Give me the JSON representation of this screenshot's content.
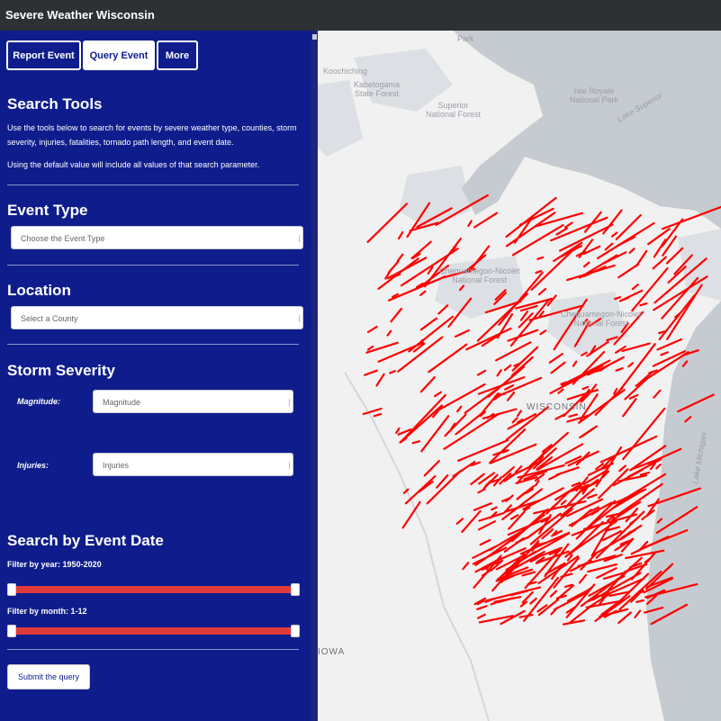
{
  "app": {
    "title": "Severe Weather Wisconsin"
  },
  "tabs": [
    {
      "label": "Report Event",
      "active": false
    },
    {
      "label": "Query Event",
      "active": true
    },
    {
      "label": "More",
      "active": false
    }
  ],
  "search_tools": {
    "title": "Search Tools",
    "description": "Use the tools below to search for events by severe weather type, counties, storm severity, injuries, fatalities, tornado path length, and event date.",
    "note": "Using the default value will include all values of that search parameter."
  },
  "event_type": {
    "title": "Event Type",
    "placeholder": "Choose the Event Type"
  },
  "location": {
    "title": "Location",
    "placeholder": "Select a County"
  },
  "storm_severity": {
    "title": "Storm Severity",
    "magnitude_label": "Magnitude:",
    "magnitude_value": "Magnitude",
    "injuries_label": "Injuries:",
    "injuries_value": "Injuries"
  },
  "event_date": {
    "title": "Search by Event Date",
    "year_filter_label": "Filter by year:",
    "year_filter_range": "1950-2020",
    "year_min_fraction": 0,
    "year_max_fraction": 1,
    "month_filter_label": "Filter by month: 1-12",
    "month_min_fraction": 0,
    "month_max_fraction": 1
  },
  "submit_label": "Submit the query",
  "map": {
    "labels": {
      "park": "Park",
      "koochiching": "Koochiching",
      "kabetogama": "Kabetogama\nState Forest",
      "superior": "Superior\nNational Forest",
      "isle_royale": "Isle Royale\nNational Park",
      "lake_superior": "Lake Superior",
      "chequamegon_1": "Chequamegon-Nicolet\nNational Forest",
      "chequamegon_2": "Chequamegon-Nicolet\nNational Forest",
      "wisconsin": "WISCONSIN",
      "lake_michigan": "Lake Michigan",
      "iowa": "IOWA"
    },
    "colors": {
      "land": "#f1f1f1",
      "water": "#c6cbd1",
      "forest": "#dcdfe3",
      "track": "#ff0000"
    }
  },
  "colors": {
    "sidebar": "#0f1d8c",
    "titlebar": "#2e3133",
    "slider_track": "#e03a3a"
  }
}
